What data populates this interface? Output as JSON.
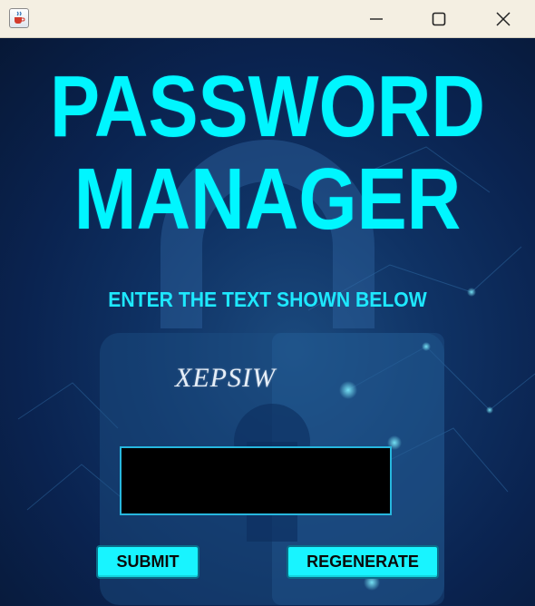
{
  "window": {
    "title": "",
    "controls": [
      "minimize-icon",
      "maximize-icon",
      "close-icon"
    ]
  },
  "app_icon": "java-cup-icon",
  "main": {
    "title_line_1": "PASSWORD",
    "title_line_2": "MANAGER",
    "instruction": "ENTER THE TEXT SHOWN BELOW",
    "captcha_text": "XEPSIW",
    "input": {
      "value": "",
      "placeholder": ""
    },
    "submit_label": "SUBMIT",
    "regenerate_label": "REGENERATE"
  },
  "colors": {
    "accent": "#00f6ff",
    "background": "#0a2350",
    "titlebar": "#f4efe2",
    "input_background": "#000000"
  }
}
